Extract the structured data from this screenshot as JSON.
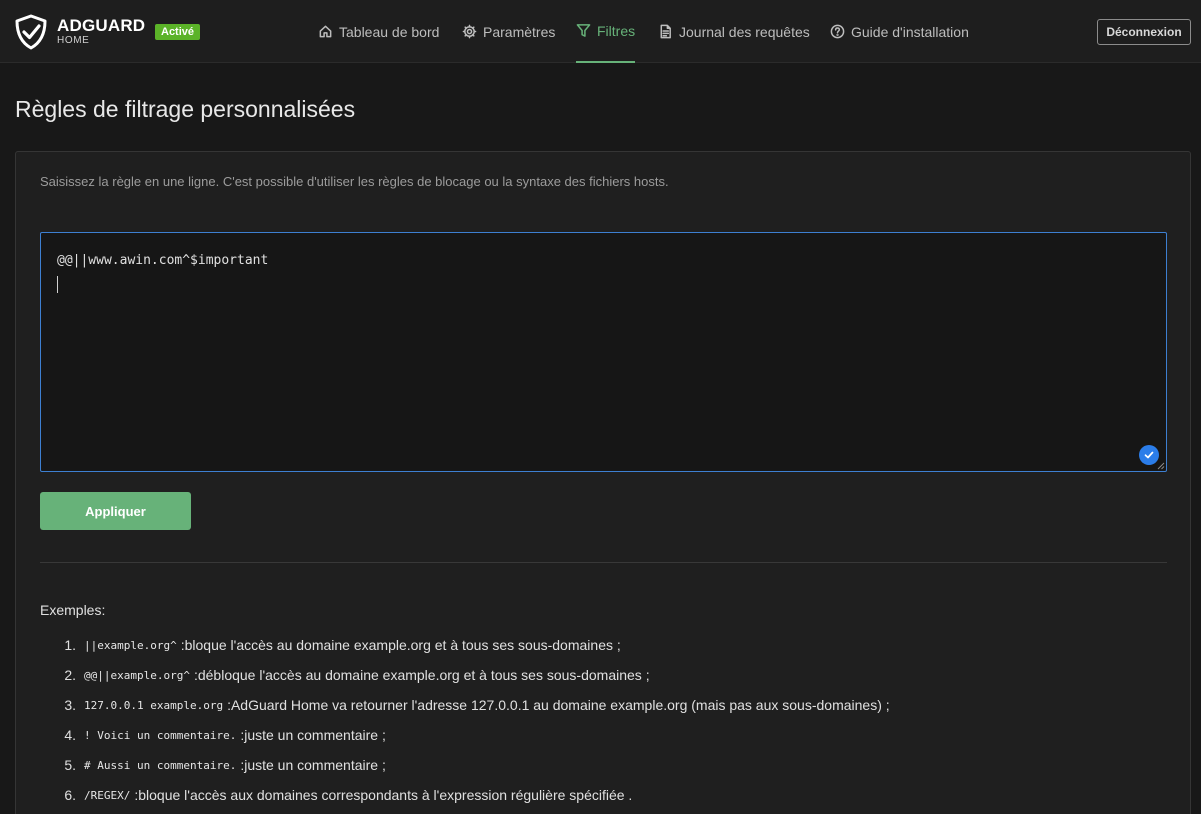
{
  "header": {
    "brand_name": "ADGUARD",
    "brand_sub": "HOME",
    "status_badge": "Activé",
    "nav": [
      {
        "label": "Tableau de bord",
        "icon": "home-icon"
      },
      {
        "label": "Paramètres",
        "icon": "gear-icon"
      },
      {
        "label": "Filtres",
        "icon": "filter-icon",
        "active": true
      },
      {
        "label": "Journal des requêtes",
        "icon": "document-icon"
      },
      {
        "label": "Guide d'installation",
        "icon": "help-circle-icon"
      }
    ],
    "logout_label": "Déconnexion"
  },
  "colors": {
    "accent": "#67b279",
    "badge": "#5bb328",
    "focus": "#3d7fd1",
    "background": "#181818"
  },
  "page": {
    "title": "Règles de filtrage personnalisées"
  },
  "editor": {
    "description": "Saisissez la règle en une ligne. C'est possible d'utiliser les règles de blocage ou la syntaxe des fichiers hosts.",
    "value": "@@||www.awin.com^$important",
    "apply_label": "Appliquer"
  },
  "examples": {
    "title": "Exemples:",
    "items": [
      {
        "num": "1.",
        "code": "||example.org^",
        "text": ":bloque l'accès au domaine example.org et à tous ses sous-domaines ;"
      },
      {
        "num": "2.",
        "code": "@@||example.org^",
        "text": ":débloque l'accès au domaine example.org et à tous ses sous-domaines ;"
      },
      {
        "num": "3.",
        "code": "127.0.0.1 example.org",
        "text": ":AdGuard Home va retourner l'adresse 127.0.0.1 au domaine example.org (mais pas aux sous-domaines) ;"
      },
      {
        "num": "4.",
        "code": "! Voici un commentaire.",
        "text": ":juste un commentaire ;"
      },
      {
        "num": "5.",
        "code": "# Aussi un commentaire.",
        "text": ":juste un commentaire ;"
      },
      {
        "num": "6.",
        "code": "/REGEX/",
        "text": ":bloque l'accès aux domaines correspondants à l'expression régulière spécifiée ."
      }
    ]
  }
}
